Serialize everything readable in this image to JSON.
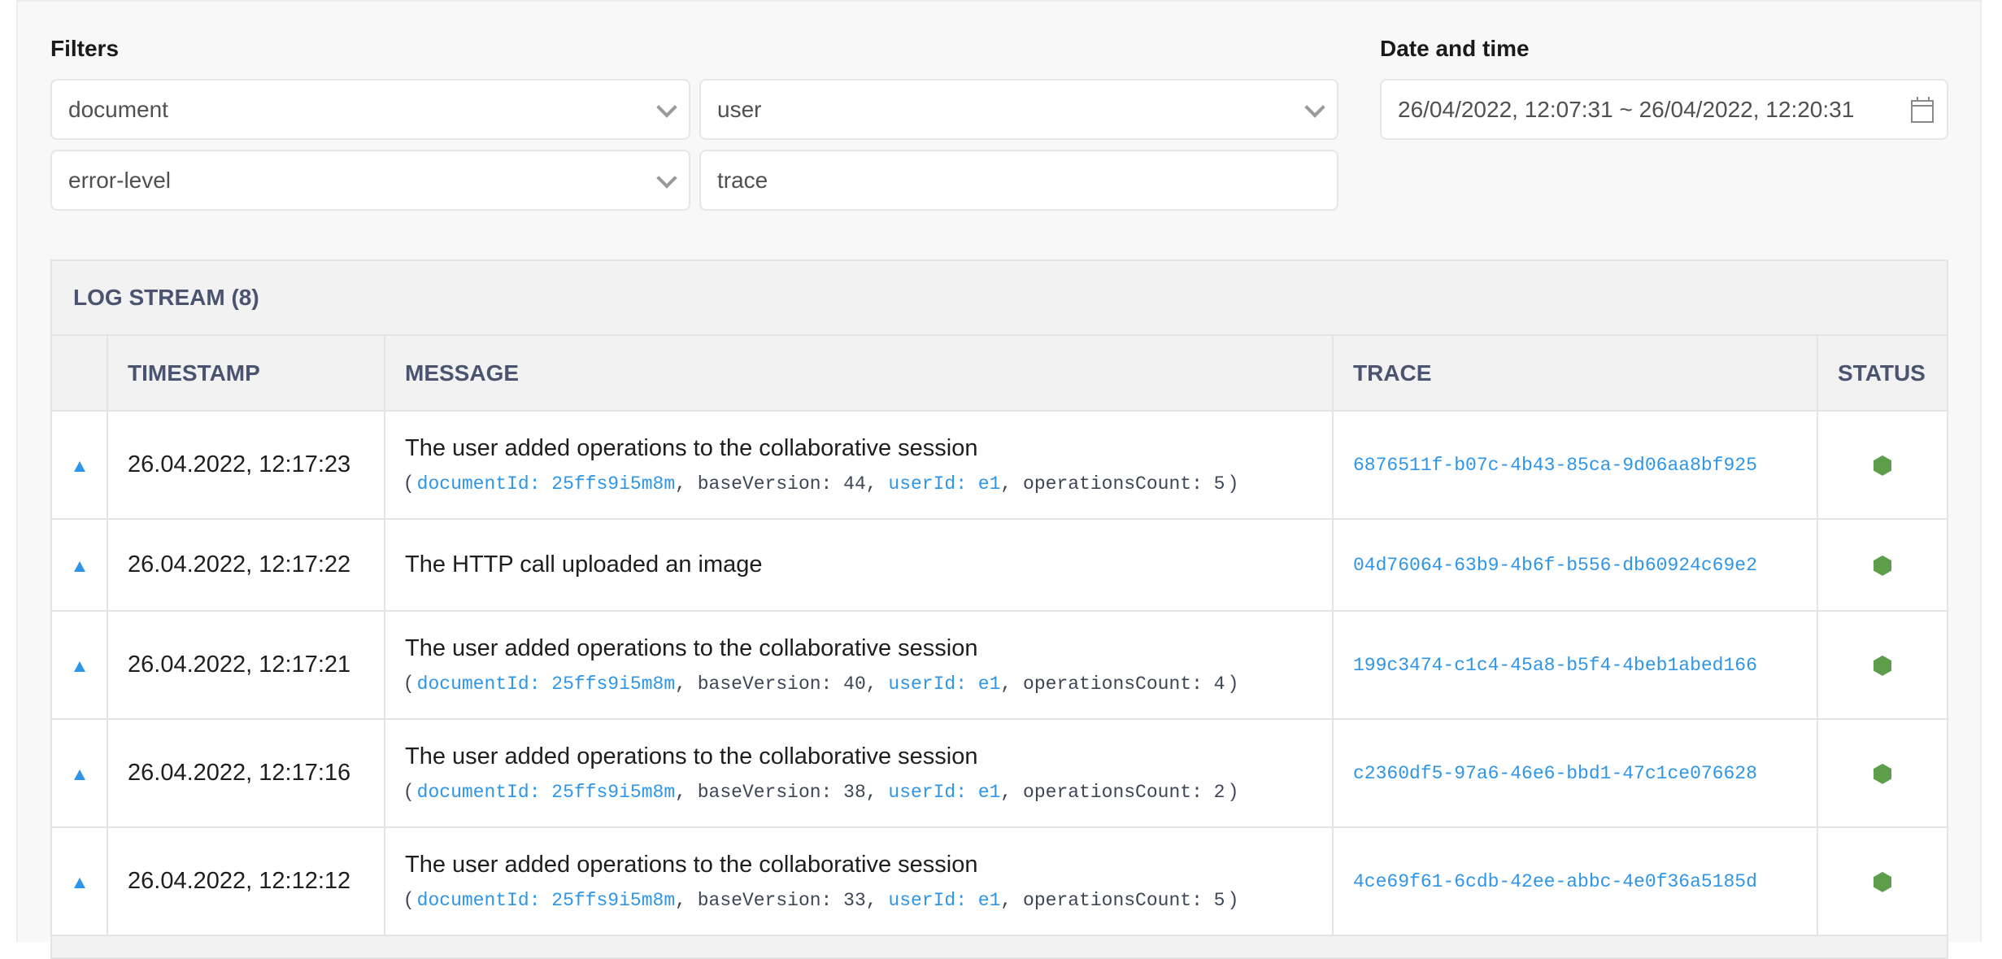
{
  "filters": {
    "label": "Filters",
    "document_select": "document",
    "user_select": "user",
    "error_level_select": "error-level",
    "trace_input": "trace"
  },
  "date_time": {
    "label": "Date and time",
    "range": "26/04/2022, 12:07:31 ~ 26/04/2022, 12:20:31",
    "icon": "calendar-icon"
  },
  "log_stream": {
    "title": "LOG STREAM (8)",
    "columns": [
      "",
      "TIMESTAMP",
      "MESSAGE",
      "TRACE",
      "STATUS"
    ],
    "status_color": "#5e9e4a",
    "accent_color": "#2e95e8",
    "rows": [
      {
        "timestamp": "26.04.2022, 12:17:23",
        "message": "The user added operations to the collaborative session",
        "details": {
          "documentId": "documentId: 25ffs9i5m8m",
          "baseVersion": "baseVersion: 44",
          "userId": "userId: e1",
          "operationsCount": "operationsCount: 5"
        },
        "trace": "6876511f-b07c-4b43-85ca-9d06aa8bf925",
        "status": "success"
      },
      {
        "timestamp": "26.04.2022, 12:17:22",
        "message": "The HTTP call uploaded an image",
        "details": null,
        "trace": "04d76064-63b9-4b6f-b556-db60924c69e2",
        "status": "success"
      },
      {
        "timestamp": "26.04.2022, 12:17:21",
        "message": "The user added operations to the collaborative session",
        "details": {
          "documentId": "documentId: 25ffs9i5m8m",
          "baseVersion": "baseVersion: 40",
          "userId": "userId: e1",
          "operationsCount": "operationsCount: 4"
        },
        "trace": "199c3474-c1c4-45a8-b5f4-4beb1abed166",
        "status": "success"
      },
      {
        "timestamp": "26.04.2022, 12:17:16",
        "message": "The user added operations to the collaborative session",
        "details": {
          "documentId": "documentId: 25ffs9i5m8m",
          "baseVersion": "baseVersion: 38",
          "userId": "userId: e1",
          "operationsCount": "operationsCount: 2"
        },
        "trace": "c2360df5-97a6-46e6-bbd1-47c1ce076628",
        "status": "success"
      },
      {
        "timestamp": "26.04.2022, 12:12:12",
        "message": "The user added operations to the collaborative session",
        "details": {
          "documentId": "documentId: 25ffs9i5m8m",
          "baseVersion": "baseVersion: 33",
          "userId": "userId: e1",
          "operationsCount": "operationsCount: 5"
        },
        "trace": "4ce69f61-6cdb-42ee-abbc-4e0f36a5185d",
        "status": "success"
      }
    ]
  }
}
